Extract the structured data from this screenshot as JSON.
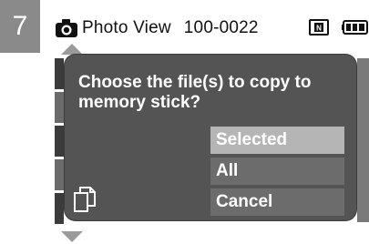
{
  "step": {
    "number": "7"
  },
  "status_bar": {
    "mode_title": "Photo View",
    "folder_file": "100-0022",
    "icons": [
      "camera-icon",
      "memory-stick-icon",
      "battery-icon"
    ]
  },
  "dialog": {
    "question": "Choose the file(s) to copy to memory stick?",
    "options": [
      {
        "label": "Selected",
        "selected": true
      },
      {
        "label": "All",
        "selected": false
      },
      {
        "label": "Cancel",
        "selected": false
      }
    ],
    "icon": "copy-icon"
  },
  "colors": {
    "dialog_bg": "#545454",
    "option_bg": "#6c6c6c",
    "option_selected_bg": "#b5b5b5",
    "step_badge_bg": "#8a8a8a"
  }
}
